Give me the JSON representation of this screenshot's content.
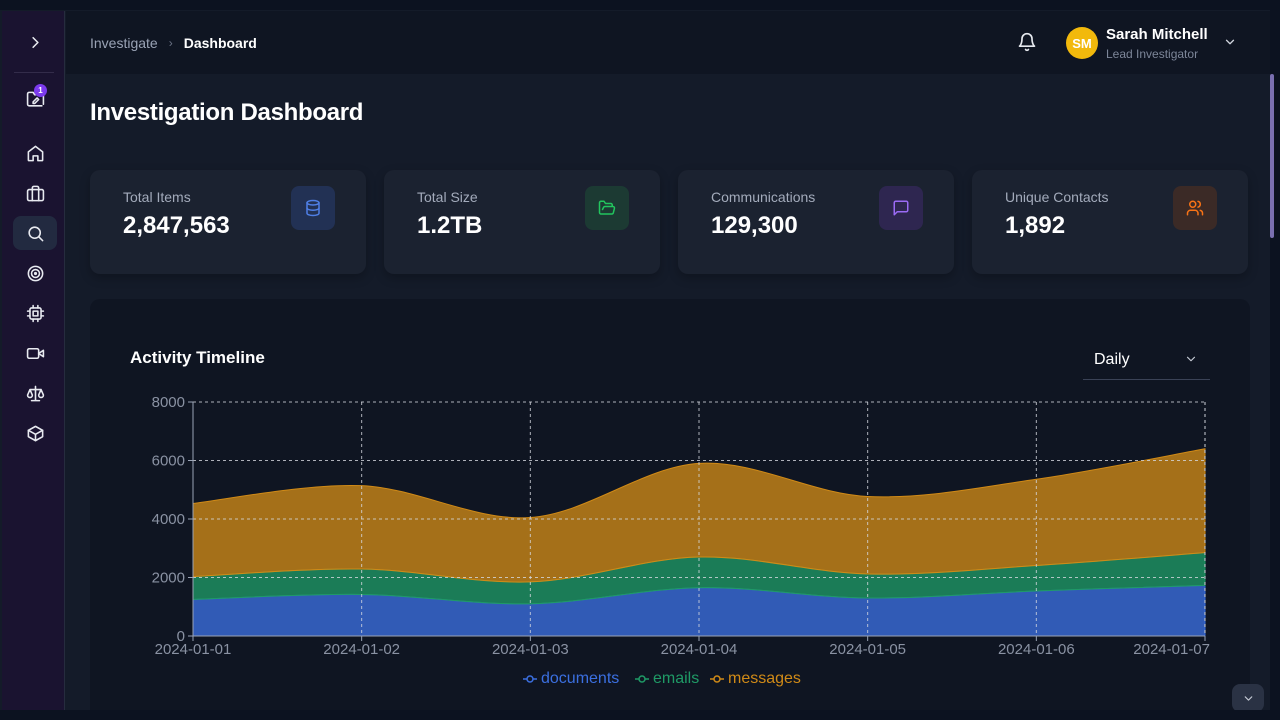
{
  "breadcrumb": {
    "parent": "Investigate",
    "current": "Dashboard"
  },
  "user": {
    "initials": "SM",
    "name": "Sarah Mitchell",
    "role": "Lead Investigator",
    "avatar_color": "#f2b90c"
  },
  "sidebar": {
    "badge_count": "1"
  },
  "page": {
    "title": "Investigation Dashboard"
  },
  "stats": [
    {
      "label": "Total Items",
      "value": "2,847,563",
      "icon": "database-icon",
      "color": "#3b6fe0"
    },
    {
      "label": "Total Size",
      "value": "1.2TB",
      "icon": "folder-open-icon",
      "color": "#22c55e"
    },
    {
      "label": "Communications",
      "value": "129,300",
      "icon": "message-square-icon",
      "color": "#8b5cf6"
    },
    {
      "label": "Unique Contacts",
      "value": "1,892",
      "icon": "users-icon",
      "color": "#f97316"
    }
  ],
  "timeline": {
    "title": "Activity Timeline",
    "period": "Daily"
  },
  "chart_data": {
    "type": "area",
    "stacked": true,
    "x": [
      "2024-01-01",
      "2024-01-02",
      "2024-01-03",
      "2024-01-04",
      "2024-01-05",
      "2024-01-06",
      "2024-01-07"
    ],
    "series": [
      {
        "name": "documents",
        "values": [
          1250,
          1420,
          1100,
          1650,
          1300,
          1540,
          1730
        ],
        "color": "#3b6fe0"
      },
      {
        "name": "emails",
        "values": [
          780,
          870,
          750,
          1050,
          820,
          870,
          1120
        ],
        "color": "#1f9a66"
      },
      {
        "name": "messages",
        "values": [
          2500,
          2850,
          2200,
          3200,
          2650,
          2950,
          3550
        ],
        "color": "#d08a17"
      }
    ],
    "ylim": [
      0,
      8000
    ],
    "yticks": [
      0,
      2000,
      4000,
      6000,
      8000
    ],
    "grid": true,
    "legend": "bottom"
  }
}
